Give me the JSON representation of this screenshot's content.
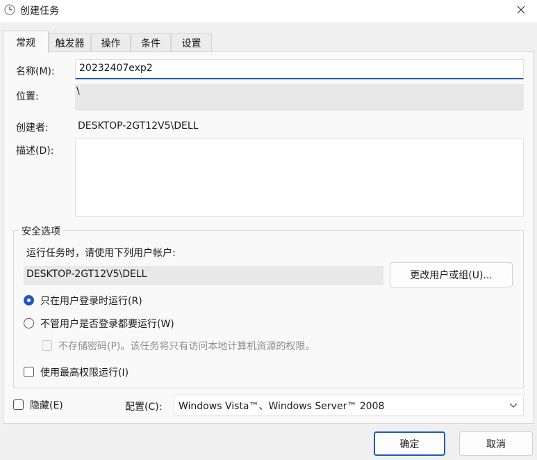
{
  "window": {
    "title": "创建任务",
    "close_glyph": "✕"
  },
  "tabs": [
    {
      "label": "常规",
      "active": true
    },
    {
      "label": "触发器",
      "active": false
    },
    {
      "label": "操作",
      "active": false
    },
    {
      "label": "条件",
      "active": false
    },
    {
      "label": "设置",
      "active": false
    }
  ],
  "general": {
    "name_label": "名称(M):",
    "name_value": "20232407exp2",
    "location_label": "位置:",
    "location_value": "\\",
    "author_label": "创建者:",
    "author_value": "DESKTOP-2GT12V5\\DELL",
    "description_label": "描述(D):",
    "description_value": ""
  },
  "security": {
    "group_title": "安全选项",
    "run_as_prompt": "运行任务时，请使用下列用户帐户:",
    "account_value": "DESKTOP-2GT12V5\\DELL",
    "change_user_button": "更改用户或组(U)...",
    "radio_logged_on": "只在用户登录时运行(R)",
    "radio_logged_on_selected": true,
    "radio_whether_logged": "不管用户是否登录都要运行(W)",
    "radio_whether_logged_selected": false,
    "no_store_password": "不存储密码(P)。该任务将只有访问本地计算机资源的权限。",
    "no_store_password_enabled": false,
    "highest_privileges": "使用最高权限运行(I)",
    "highest_privileges_checked": false
  },
  "footer": {
    "hidden_label": "隐藏(E)",
    "hidden_checked": false,
    "configure_label": "配置(C):",
    "configure_value": "Windows Vista™、Windows Server™ 2008"
  },
  "buttons": {
    "ok": "确定",
    "cancel": "取消"
  },
  "colors": {
    "accent": "#1e57c5",
    "input_underline": "#1c5cb1",
    "disabled_text": "#8d8d8d"
  },
  "icons": {
    "window": "clock-icon",
    "close": "close-icon",
    "dropdown": "chevron-down-icon"
  }
}
